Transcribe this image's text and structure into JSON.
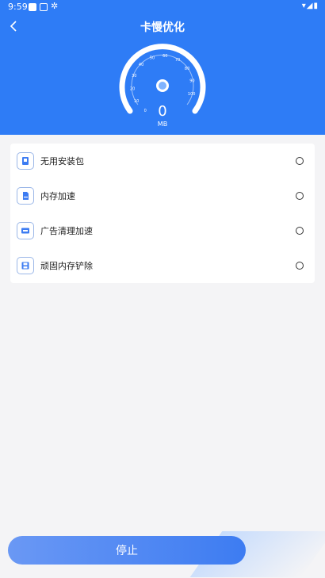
{
  "status_bar": {
    "time": "9:59",
    "icons": [
      "square-icon",
      "settings-square-icon",
      "bug-icon",
      "wifi-icon",
      "signal-icon",
      "battery-icon"
    ]
  },
  "header": {
    "title": "卡慢优化",
    "back_icon": "chevron-left-icon"
  },
  "gauge": {
    "value": "0",
    "unit": "MB",
    "ticks": [
      "0",
      "10",
      "20",
      "30",
      "40",
      "50",
      "60",
      "70",
      "80",
      "90",
      "100"
    ]
  },
  "items": [
    {
      "label": "无用安装包",
      "icon": "package-icon"
    },
    {
      "label": "内存加速",
      "icon": "memory-card-icon"
    },
    {
      "label": "广告清理加速",
      "icon": "ad-icon"
    },
    {
      "label": "顽固内存铲除",
      "icon": "floppy-icon"
    }
  ],
  "action": {
    "stop_label": "停止"
  },
  "colors": {
    "primary": "#2e7cf6",
    "background": "#f4f4f6"
  }
}
